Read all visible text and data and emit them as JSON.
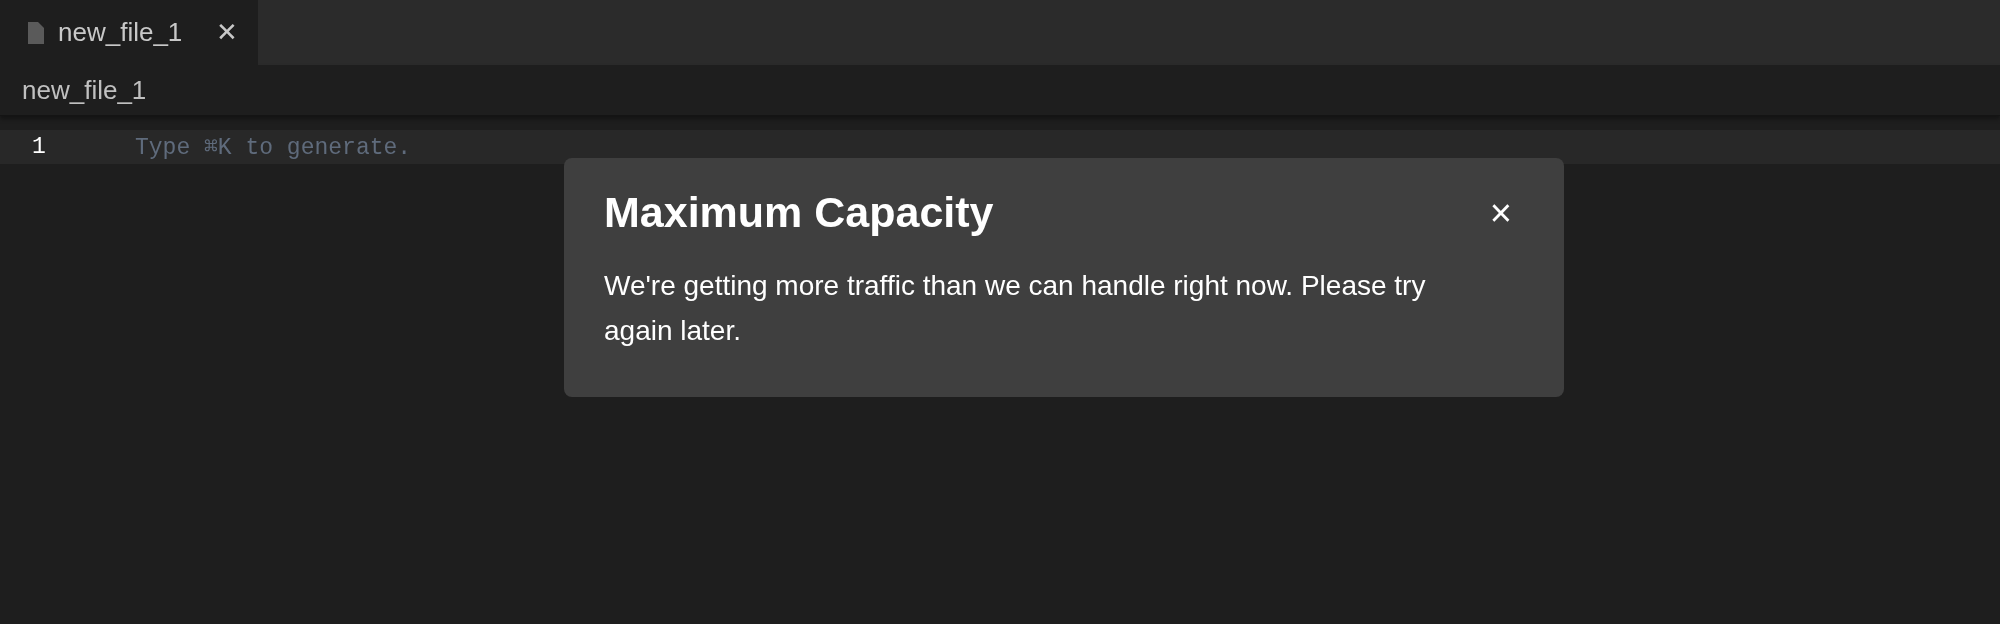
{
  "tabs": [
    {
      "label": "new_file_1",
      "selected": true,
      "close": "✕"
    }
  ],
  "breadcrumb": "new_file_1",
  "editor": {
    "lines": [
      {
        "number": "1",
        "placeholder": "Type ⌘K to generate."
      }
    ]
  },
  "dialog": {
    "title": "Maximum Capacity",
    "close": "×",
    "message": "We're getting more traffic than we can handle right now. Please try again later."
  }
}
